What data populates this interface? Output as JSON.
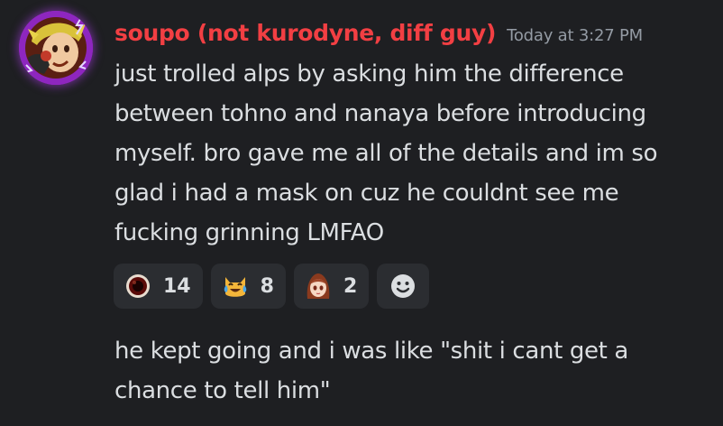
{
  "message": {
    "author": "soupo (not kurodyne, diff guy)",
    "timestamp": "Today at 3:27 PM",
    "lines": [
      "just trolled alps by asking him the difference",
      "between tohno and nanaya before introducing",
      "myself. bro gave me all of the details and im so",
      "glad i had a mask on cuz he couldnt see me",
      "fucking grinning LMFAO"
    ],
    "reactions": [
      {
        "icon": "dark-orb-emoji",
        "count": "14"
      },
      {
        "icon": "cat-tears-of-joy-emoji",
        "count": "8"
      },
      {
        "icon": "anime-girl-emoji",
        "count": "2"
      }
    ],
    "add_reaction_icon": "smiley-add-reaction-icon"
  },
  "followup": {
    "lines": [
      "he kept going and i was like \"shit i cant get a",
      "chance to tell him\""
    ]
  },
  "colors": {
    "background": "#1e1f22",
    "username": "#f23f43",
    "timestamp": "#949ba4",
    "text": "#dbdee1",
    "reaction_bg": "#2b2d31",
    "avatar_ring": "#9b2cc9"
  }
}
